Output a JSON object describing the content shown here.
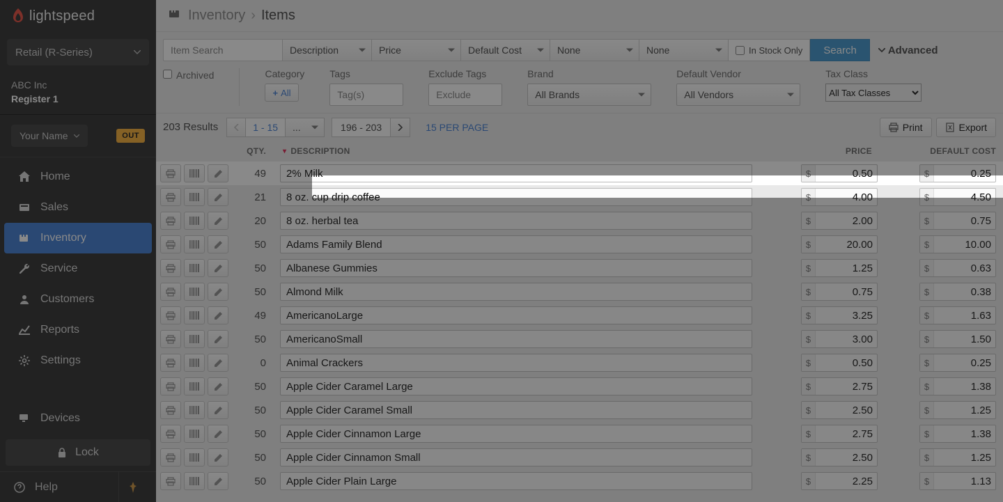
{
  "brand": "lightspeed",
  "series": "Retail (R-Series)",
  "company": "ABC Inc",
  "register": "Register 1",
  "user": "Your Name",
  "out_badge": "OUT",
  "nav": {
    "home": "Home",
    "sales": "Sales",
    "inventory": "Inventory",
    "service": "Service",
    "customers": "Customers",
    "reports": "Reports",
    "settings": "Settings",
    "devices": "Devices"
  },
  "lock": "Lock",
  "help": "Help",
  "breadcrumb": {
    "parent": "Inventory",
    "current": "Items"
  },
  "filters": {
    "search_ph": "Item Search",
    "desc": "Description",
    "price": "Price",
    "defcost": "Default Cost",
    "none1": "None",
    "none2": "None",
    "instock": "In Stock Only",
    "search_btn": "Search",
    "advanced": "Advanced",
    "archived": "Archived",
    "category_lbl": "Category",
    "all_btn": "All",
    "tags_lbl": "Tags",
    "tags_ph": "Tag(s)",
    "exclude_lbl": "Exclude Tags",
    "exclude_ph": "Exclude",
    "brand_lbl": "Brand",
    "brand_val": "All Brands",
    "vendor_lbl": "Default Vendor",
    "vendor_val": "All Vendors",
    "tax_lbl": "Tax Class",
    "tax_val": "All Tax Classes"
  },
  "results": {
    "count": "203 Results",
    "range": "1 - 15",
    "dots": "...",
    "last": "196 - 203",
    "perpage": "15 PER PAGE",
    "print": "Print",
    "export": "Export"
  },
  "columns": {
    "qty": "QTY.",
    "desc": "DESCRIPTION",
    "price": "PRICE",
    "cost": "DEFAULT COST"
  },
  "items": [
    {
      "qty": 49,
      "desc": "2% Milk",
      "price": "0.50",
      "cost": "0.25"
    },
    {
      "qty": 21,
      "desc": "8 oz. cup drip coffee",
      "price": "4.00",
      "cost": "4.50"
    },
    {
      "qty": 20,
      "desc": "8 oz. herbal tea",
      "price": "2.00",
      "cost": "0.75"
    },
    {
      "qty": 50,
      "desc": "Adams Family Blend",
      "price": "20.00",
      "cost": "10.00"
    },
    {
      "qty": 50,
      "desc": "Albanese Gummies",
      "price": "1.25",
      "cost": "0.63"
    },
    {
      "qty": 50,
      "desc": "Almond Milk",
      "price": "0.75",
      "cost": "0.38"
    },
    {
      "qty": 49,
      "desc": "AmericanoLarge",
      "price": "3.25",
      "cost": "1.63"
    },
    {
      "qty": 50,
      "desc": "AmericanoSmall",
      "price": "3.00",
      "cost": "1.50"
    },
    {
      "qty": 0,
      "desc": "Animal Crackers",
      "price": "0.50",
      "cost": "0.25"
    },
    {
      "qty": 50,
      "desc": "Apple Cider Caramel Large",
      "price": "2.75",
      "cost": "1.38"
    },
    {
      "qty": 50,
      "desc": "Apple Cider Caramel Small",
      "price": "2.50",
      "cost": "1.25"
    },
    {
      "qty": 50,
      "desc": "Apple Cider Cinnamon Large",
      "price": "2.75",
      "cost": "1.38"
    },
    {
      "qty": 50,
      "desc": "Apple Cider Cinnamon Small",
      "price": "2.50",
      "cost": "1.25"
    },
    {
      "qty": 50,
      "desc": "Apple Cider Plain Large",
      "price": "2.25",
      "cost": "1.13"
    }
  ]
}
